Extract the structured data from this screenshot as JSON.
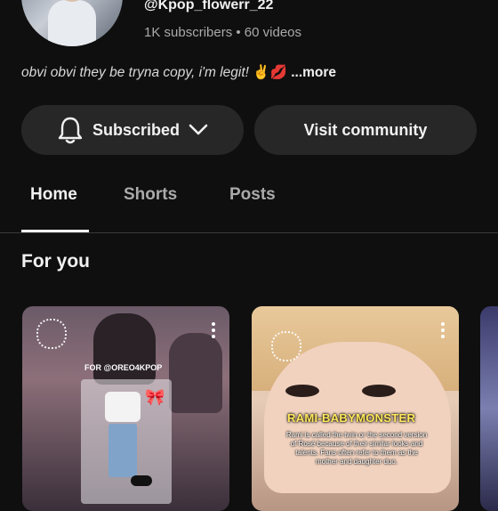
{
  "channel": {
    "handle": "@Kpop_flowerr_22",
    "meta": "1K subscribers • 60 videos",
    "description_text": "obvi obvi they be tryna copy, i'm legit! ",
    "description_emoji": "✌️💋",
    "description_more": "...more"
  },
  "actions": {
    "subscribed_label": "Subscribed",
    "community_label": "Visit community"
  },
  "tabs": [
    {
      "label": "Home",
      "active": true
    },
    {
      "label": "Shorts",
      "active": false
    },
    {
      "label": "Posts",
      "active": false
    }
  ],
  "section": {
    "title": "For you"
  },
  "shorts": [
    {
      "overlay_text": "FOR @OREO4KPOP"
    },
    {
      "overlay_title": "RAMI-BABYMONSTER",
      "overlay_lines": "Rami is called the twin or the second version of Rosé because of their similar looks and talents. Fans often refer to them as the mother and daughter duo."
    },
    {}
  ],
  "colors": {
    "background": "#0f0f0f",
    "button_bg": "#272727",
    "text_primary": "#f1f1f1",
    "text_secondary": "#aaaaaa"
  }
}
